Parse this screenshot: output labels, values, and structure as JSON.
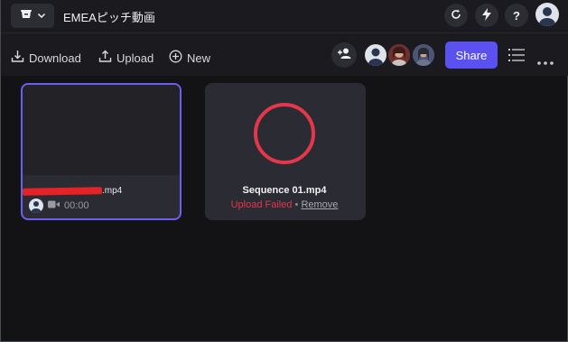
{
  "header": {
    "title": "EMEAピッチ動画"
  },
  "toolbar": {
    "download_label": "Download",
    "upload_label": "Upload",
    "new_label": "New",
    "share_label": "Share"
  },
  "assets": [
    {
      "name_suffix": ".mp4",
      "duration": "00:00"
    },
    {
      "name": "Sequence 01.mp4",
      "status": "Upload Failed",
      "separator": "•",
      "action": "Remove"
    }
  ],
  "colors": {
    "accent": "#5b50f0",
    "error": "#e5364a",
    "background": "#131316"
  }
}
